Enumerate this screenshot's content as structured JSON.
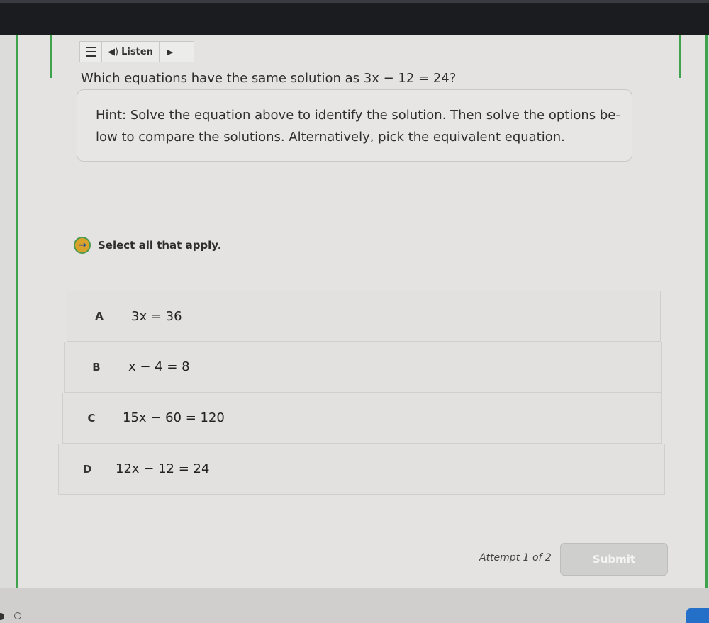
{
  "toolbar": {
    "listen_label": "Listen"
  },
  "question": {
    "prefix": "Which equations have the same solution as ",
    "equation": "3x − 12 = 24",
    "suffix": "?"
  },
  "hint": {
    "line1": "Hint: Solve the equation above to identify the solution. Then solve the options be-",
    "line2": "low to compare the solutions. Alternatively, pick the equivalent equation."
  },
  "instruction": "Select all that apply.",
  "options": [
    {
      "letter": "A",
      "equation": "3x = 36"
    },
    {
      "letter": "B",
      "equation": "x − 4 = 8"
    },
    {
      "letter": "C",
      "equation": "15x − 60 = 120"
    },
    {
      "letter": "D",
      "equation": "12x − 12 = 24"
    }
  ],
  "footer": {
    "attempt": "Attempt 1 of 2",
    "submit_label": "Submit"
  }
}
